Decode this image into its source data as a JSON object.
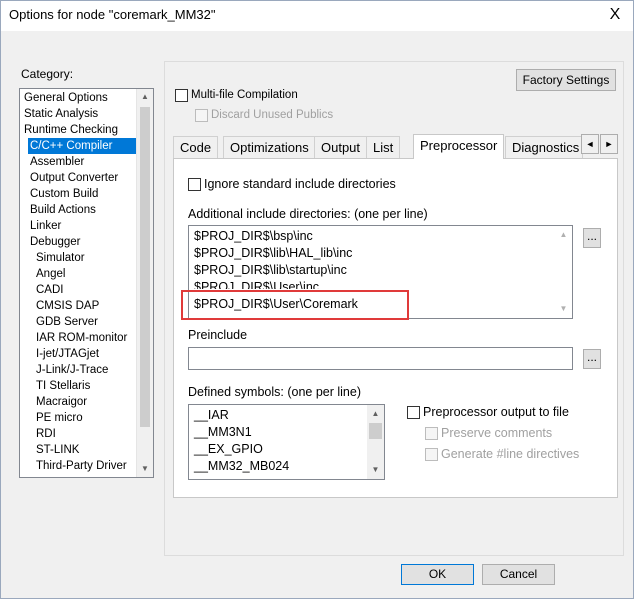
{
  "window": {
    "title": "Options for node \"coremark_MM32\"",
    "close_symbol": "X"
  },
  "category": {
    "label": "Category:",
    "items": [
      {
        "label": "General Options",
        "level": 0,
        "selected": false
      },
      {
        "label": "Static Analysis",
        "level": 0,
        "selected": false
      },
      {
        "label": "Runtime Checking",
        "level": 0,
        "selected": false
      },
      {
        "label": "C/C++ Compiler",
        "level": 1,
        "selected": true
      },
      {
        "label": "Assembler",
        "level": 1,
        "selected": false
      },
      {
        "label": "Output Converter",
        "level": 1,
        "selected": false
      },
      {
        "label": "Custom Build",
        "level": 1,
        "selected": false
      },
      {
        "label": "Build Actions",
        "level": 1,
        "selected": false
      },
      {
        "label": "Linker",
        "level": 1,
        "selected": false
      },
      {
        "label": "Debugger",
        "level": 1,
        "selected": false
      },
      {
        "label": "Simulator",
        "level": 2,
        "selected": false
      },
      {
        "label": "Angel",
        "level": 2,
        "selected": false
      },
      {
        "label": "CADI",
        "level": 2,
        "selected": false
      },
      {
        "label": "CMSIS DAP",
        "level": 2,
        "selected": false
      },
      {
        "label": "GDB Server",
        "level": 2,
        "selected": false
      },
      {
        "label": "IAR ROM-monitor",
        "level": 2,
        "selected": false
      },
      {
        "label": "I-jet/JTAGjet",
        "level": 2,
        "selected": false
      },
      {
        "label": "J-Link/J-Trace",
        "level": 2,
        "selected": false
      },
      {
        "label": "TI Stellaris",
        "level": 2,
        "selected": false
      },
      {
        "label": "Macraigor",
        "level": 2,
        "selected": false
      },
      {
        "label": "PE micro",
        "level": 2,
        "selected": false
      },
      {
        "label": "RDI",
        "level": 2,
        "selected": false
      },
      {
        "label": "ST-LINK",
        "level": 2,
        "selected": false
      },
      {
        "label": "Third-Party Driver",
        "level": 2,
        "selected": false
      }
    ]
  },
  "top": {
    "factory_settings": "Factory Settings",
    "multifile": "Multi-file Compilation",
    "discard": "Discard Unused Publics"
  },
  "tabs": {
    "items": [
      "Code",
      "Optimizations",
      "Output",
      "List",
      "Preprocessor",
      "Diagnostics"
    ],
    "active": "Preprocessor",
    "left_arrow": "◄",
    "right_arrow": "►"
  },
  "preprocessor": {
    "ignore_std": "Ignore standard include directories",
    "include_label": "Additional include directories: (one per line)",
    "include_lines": [
      "$PROJ_DIR$\\bsp\\inc",
      "$PROJ_DIR$\\lib\\HAL_lib\\inc",
      "$PROJ_DIR$\\lib\\startup\\inc",
      "$PROJ_DIR$\\User\\inc",
      "$PROJ_DIR$\\User\\Coremark"
    ],
    "ellipsis": "...",
    "preinclude_label": "Preinclude",
    "preinclude_value": "",
    "symbols_label": "Defined symbols: (one per line)",
    "symbols": [
      "__IAR",
      "__MM3N1",
      "__EX_GPIO",
      "__MM32_MB024"
    ],
    "pp_output": "Preprocessor output to file",
    "preserve_comments": "Preserve comments",
    "generate_line": "Generate #line directives"
  },
  "footer": {
    "ok": "OK",
    "cancel": "Cancel"
  }
}
